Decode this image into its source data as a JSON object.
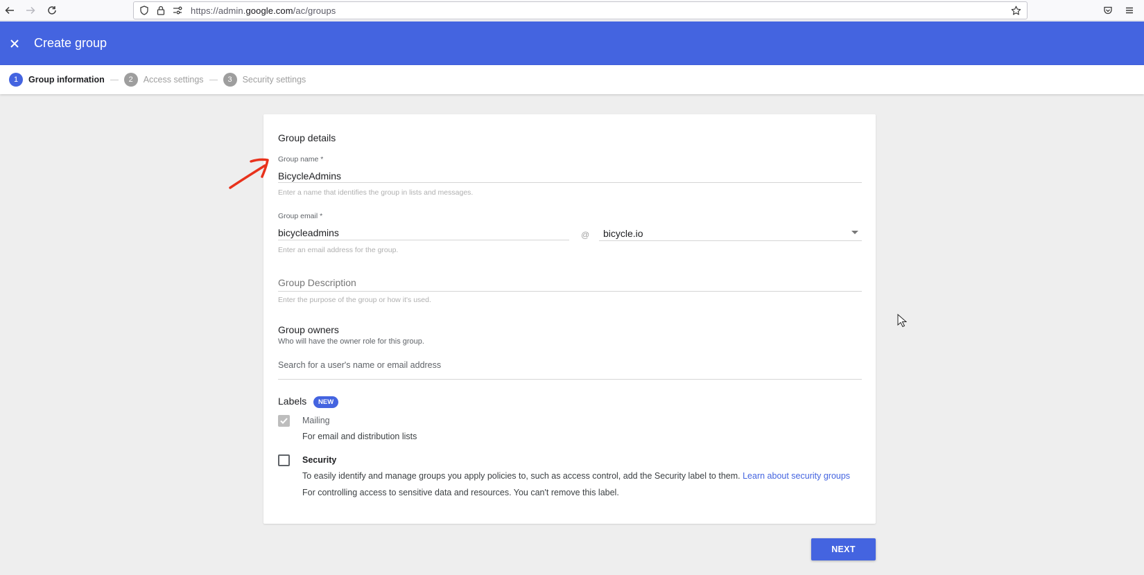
{
  "browser": {
    "url_scheme": "https://admin.",
    "url_host": "google.com",
    "url_path": "/ac/groups"
  },
  "header": {
    "title": "Create group"
  },
  "stepper": {
    "steps": [
      {
        "number": "1",
        "label": "Group information",
        "active": true
      },
      {
        "number": "2",
        "label": "Access settings",
        "active": false
      },
      {
        "number": "3",
        "label": "Security settings",
        "active": false
      }
    ]
  },
  "form": {
    "section_title": "Group details",
    "group_name": {
      "label": "Group name *",
      "value": "BicycleAdmins",
      "hint": "Enter a name that identifies the group in lists and messages."
    },
    "group_email": {
      "label": "Group email *",
      "value": "bicycleadmins",
      "at": "@",
      "domain": "bicycle.io",
      "hint": "Enter an email address for the group."
    },
    "group_description": {
      "placeholder": "Group Description",
      "hint": "Enter the purpose of the group or how it's used."
    },
    "group_owners": {
      "title": "Group owners",
      "subtitle": "Who will have the owner role for this group.",
      "search_placeholder": "Search for a user's name or email address"
    },
    "labels": {
      "title": "Labels",
      "badge": "NEW",
      "mailing": {
        "label": "Mailing",
        "checked": true,
        "description": "For email and distribution lists"
      },
      "security": {
        "label": "Security",
        "checked": false,
        "description": "To easily identify and manage groups you apply policies to, such as access control, add the Security label to them.",
        "link": "Learn about security groups",
        "description2": "For controlling access to sensitive data and resources. You can't remove this label."
      }
    }
  },
  "actions": {
    "next_label": "NEXT"
  },
  "colors": {
    "accent": "#4464e0",
    "annotation": "#e8321c"
  }
}
